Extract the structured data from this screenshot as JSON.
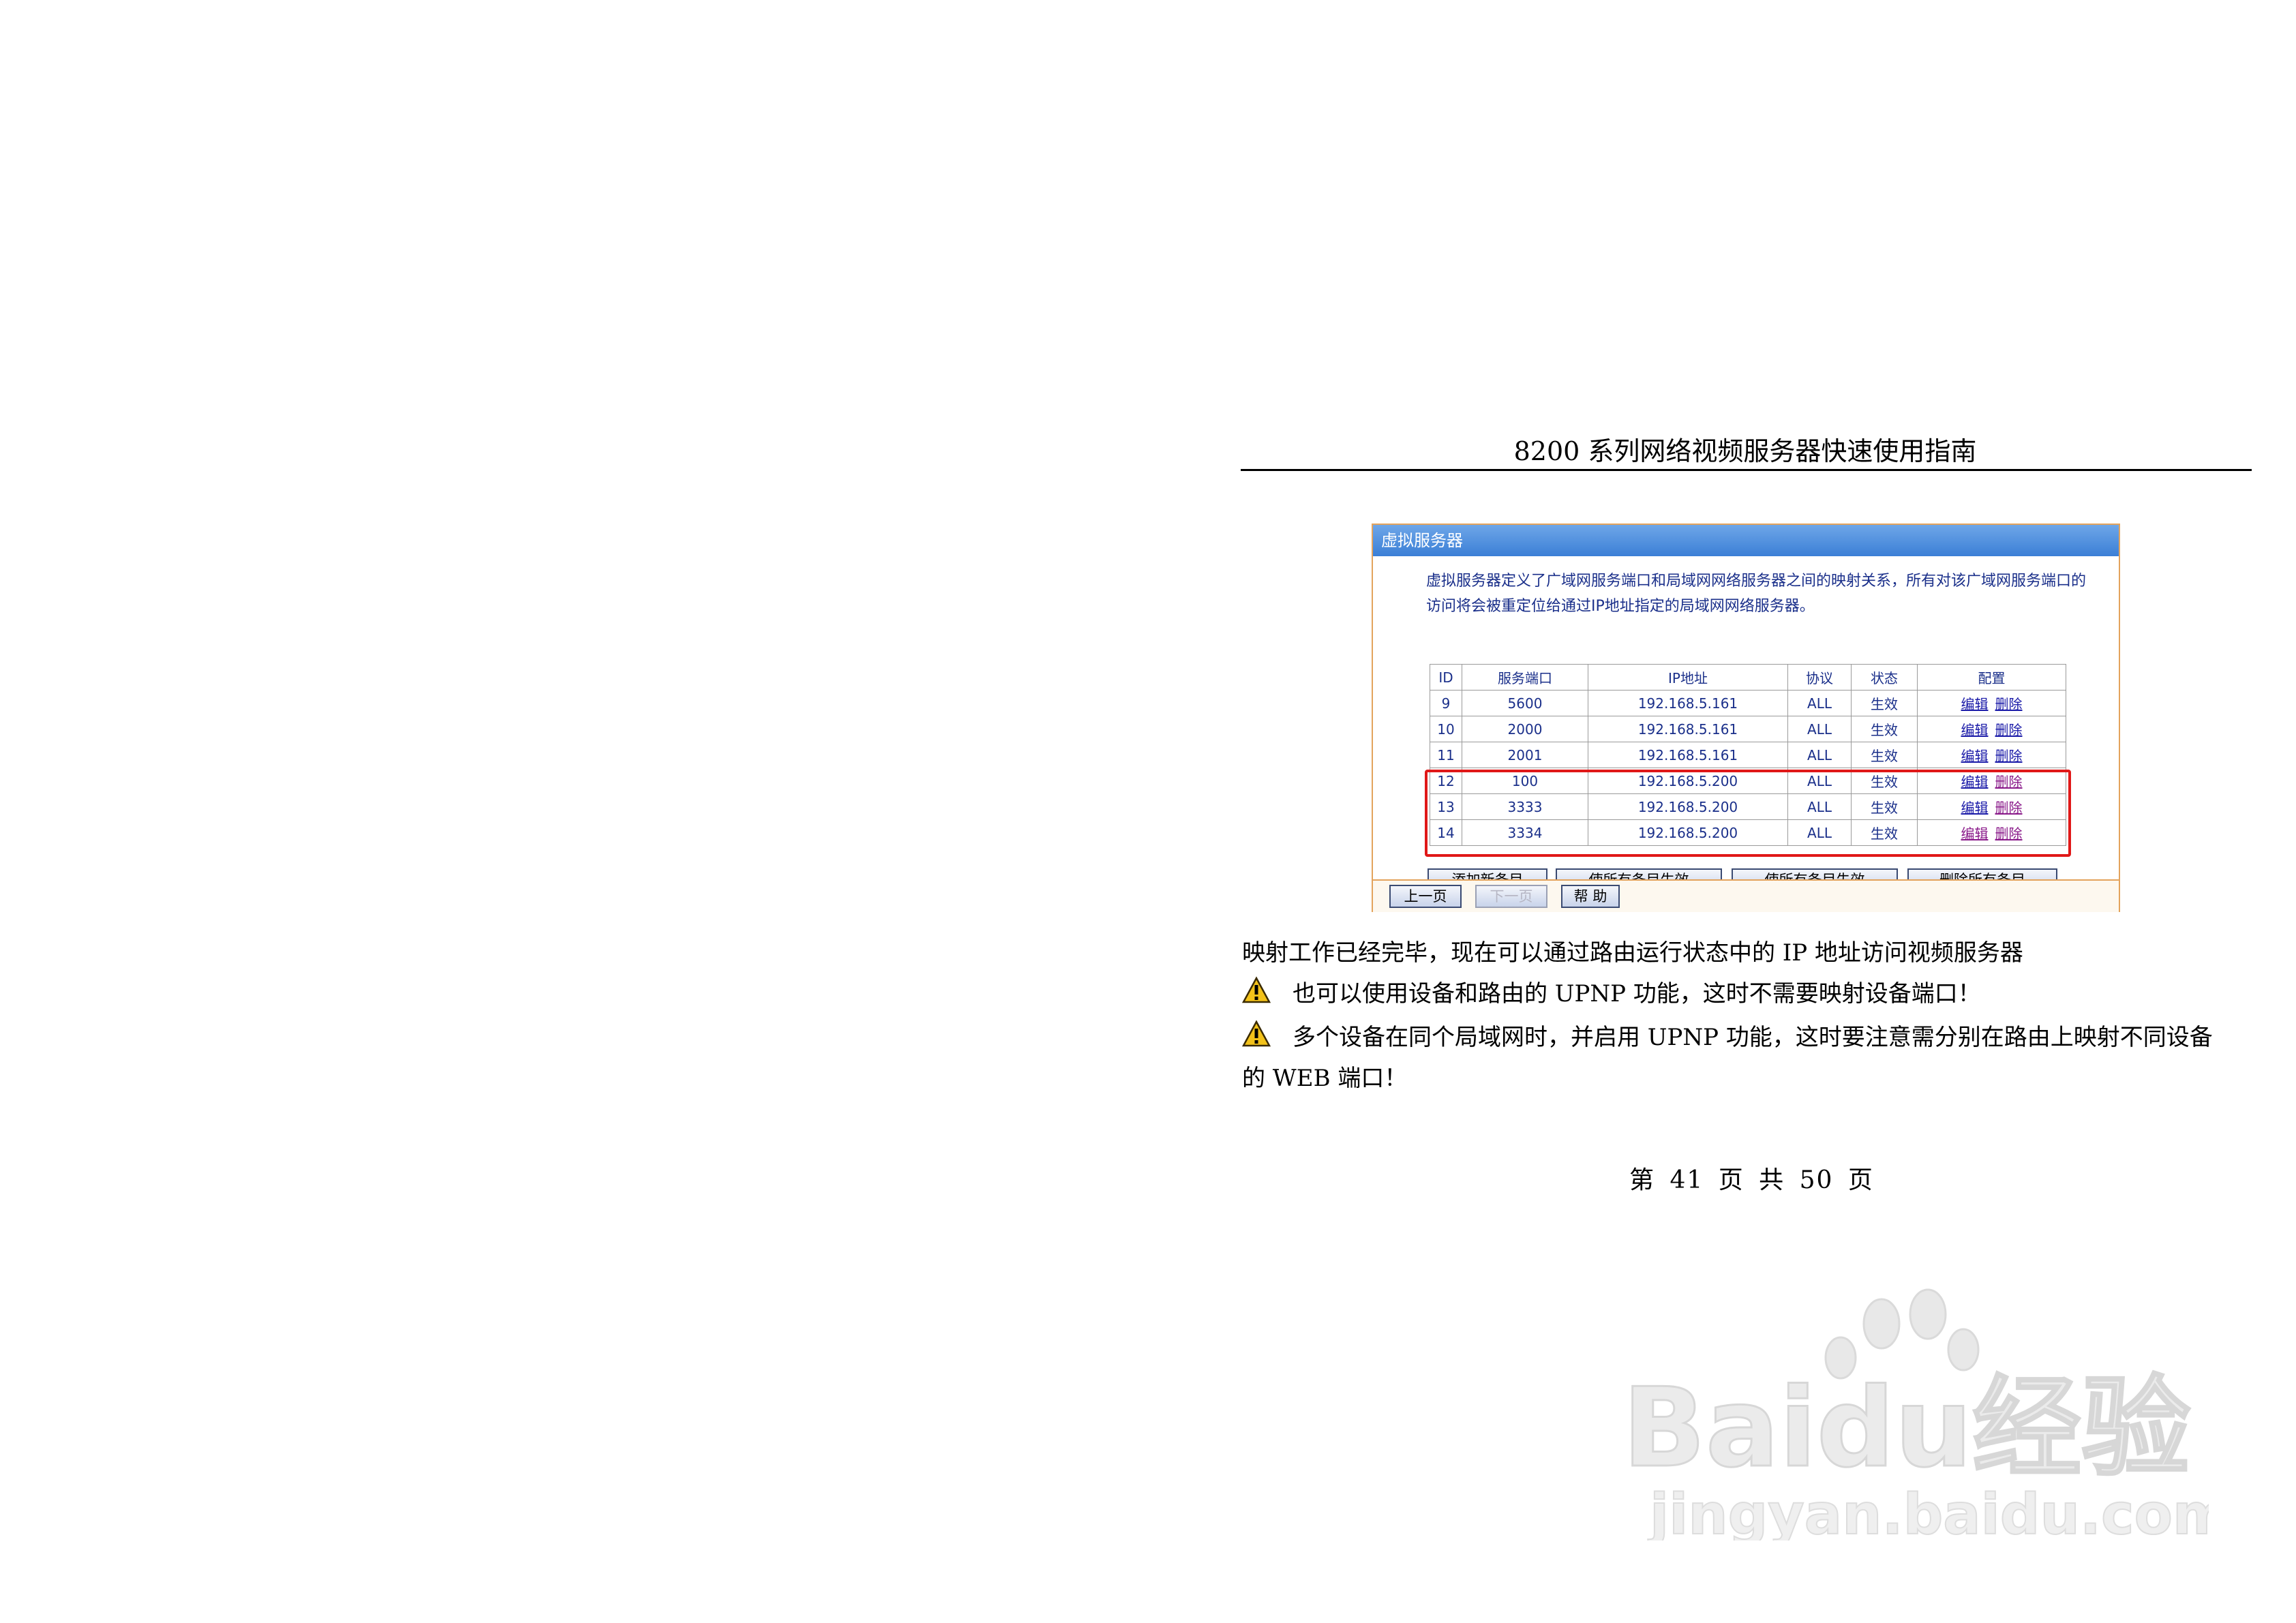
{
  "document": {
    "header_title": "8200 系列网络视频服务器快速使用指南",
    "footer_page": "第 41 页 共 50 页"
  },
  "router_ui": {
    "title": "虚拟服务器",
    "description": "虚拟服务器定义了广域网服务端口和局域网网络服务器之间的映射关系，所有对该广域网服务端口的访问将会被重定位给通过IP地址指定的局域网网络服务器。",
    "table": {
      "columns": [
        "ID",
        "服务端口",
        "IP地址",
        "协议",
        "状态",
        "配置"
      ],
      "rows": [
        {
          "id": "9",
          "port": "5600",
          "ip": "192.168.5.161",
          "protocol": "ALL",
          "status": "生效",
          "edit": "编辑",
          "delete": "删除"
        },
        {
          "id": "10",
          "port": "2000",
          "ip": "192.168.5.161",
          "protocol": "ALL",
          "status": "生效",
          "edit": "编辑",
          "delete": "删除"
        },
        {
          "id": "11",
          "port": "2001",
          "ip": "192.168.5.161",
          "protocol": "ALL",
          "status": "生效",
          "edit": "编辑",
          "delete": "删除"
        },
        {
          "id": "12",
          "port": "100",
          "ip": "192.168.5.200",
          "protocol": "ALL",
          "status": "生效",
          "edit": "编辑",
          "delete": "删除"
        },
        {
          "id": "13",
          "port": "3333",
          "ip": "192.168.5.200",
          "protocol": "ALL",
          "status": "生效",
          "edit": "编辑",
          "delete": "删除"
        },
        {
          "id": "14",
          "port": "3334",
          "ip": "192.168.5.200",
          "protocol": "ALL",
          "status": "生效",
          "edit": "编辑",
          "delete": "删除"
        }
      ]
    },
    "buttons": {
      "add_new": "添加新条目",
      "enable_all": "使所有条目生效",
      "disable_all": "使所有条目失效",
      "delete_all": "删除所有条目",
      "prev_page": "上一页",
      "next_page": "下一页",
      "help": "帮 助"
    },
    "colors": {
      "title_bar": "#3b7fd6",
      "panel_border": "#e3a35c",
      "text_blue": "#1a2f8a",
      "highlight_red": "#e01818"
    }
  },
  "body": {
    "line1": "映射工作已经完毕，现在可以通过路由运行状态中的 IP 地址访问视频服务器",
    "warning1": "也可以使用设备和路由的 UPNP 功能，这时不需要映射设备端口！",
    "warning2_line1": "多个设备在同个局域网时，并启用 UPNP 功能，这时要注意需分别在路由上映射不同设备",
    "warning2_line2": "的 WEB 端口！",
    "warning_icon": "warning-triangle-icon"
  },
  "watermark": {
    "logo_text": "Baidu经验",
    "url_text": "jingyan.baidu.com"
  }
}
